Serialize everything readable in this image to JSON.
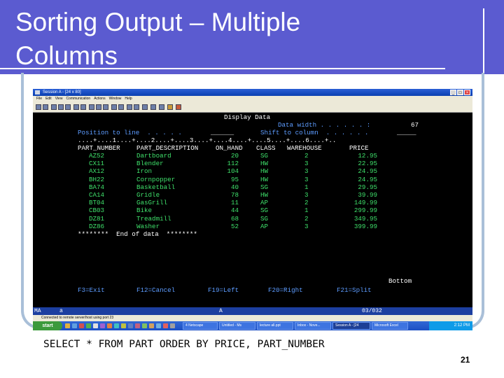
{
  "slide": {
    "title_line1": "Sorting Output – Multiple",
    "title_line2": "Columns",
    "caption": "SELECT * FROM PART ORDER BY PRICE, PART_NUMBER",
    "page_number": "21"
  },
  "window": {
    "title": "Session A - [24 x 80]",
    "menu": [
      "File",
      "Edit",
      "View",
      "Communication",
      "Actions",
      "Window",
      "Help"
    ],
    "controls": [
      "_",
      "□",
      "×"
    ]
  },
  "terminal": {
    "header": "Display Data",
    "data_width_label": "Data width . . . . . . :",
    "data_width_value": "67",
    "position_label": "Position to line  . . . . .",
    "position_value": "______",
    "shift_label": "Shift to column  . . . . . .",
    "shift_value": "_____",
    "ruler": "....+....1....+....2....+....3....+....4....+....5....+....6....+..",
    "columns": [
      "PART_NUMBER",
      "PART_DESCRIPTION",
      "ON_HAND",
      "CLASS",
      "WAREHOUSE",
      "PRICE"
    ],
    "rows": [
      {
        "part_number": "AZ52",
        "description": "Dartboard",
        "on_hand": "20",
        "class": "SG",
        "warehouse": "2",
        "price": "12.95"
      },
      {
        "part_number": "CX11",
        "description": "Blender",
        "on_hand": "112",
        "class": "HW",
        "warehouse": "3",
        "price": "22.95"
      },
      {
        "part_number": "AX12",
        "description": "Iron",
        "on_hand": "104",
        "class": "HW",
        "warehouse": "3",
        "price": "24.95"
      },
      {
        "part_number": "BH22",
        "description": "Cornpopper",
        "on_hand": "95",
        "class": "HW",
        "warehouse": "3",
        "price": "24.95"
      },
      {
        "part_number": "BA74",
        "description": "Basketball",
        "on_hand": "40",
        "class": "SG",
        "warehouse": "1",
        "price": "29.95"
      },
      {
        "part_number": "CA14",
        "description": "Gridle",
        "on_hand": "78",
        "class": "HW",
        "warehouse": "3",
        "price": "39.99"
      },
      {
        "part_number": "BT04",
        "description": "GasGrill",
        "on_hand": "11",
        "class": "AP",
        "warehouse": "2",
        "price": "149.99"
      },
      {
        "part_number": "CB03",
        "description": "Bike",
        "on_hand": "44",
        "class": "SG",
        "warehouse": "1",
        "price": "299.99"
      },
      {
        "part_number": "DZ81",
        "description": "Treadmill",
        "on_hand": "68",
        "class": "SG",
        "warehouse": "2",
        "price": "349.95"
      },
      {
        "part_number": "DZ86",
        "description": "Washer",
        "on_hand": "52",
        "class": "AP",
        "warehouse": "3",
        "price": "399.99"
      }
    ],
    "end_text": "********  End of data  ********",
    "bottom_text": "Bottom",
    "fkeys": [
      "F3=Exit",
      "F12=Cancel",
      "F19=Left",
      "F20=Right",
      "F21=Split"
    ]
  },
  "status_bar": {
    "left": "MA",
    "session": "a",
    "mode": "A",
    "position": "03/032"
  },
  "message_bar": "Connected to remote server/host using port 23",
  "taskbar": {
    "start": "start",
    "tasks": [
      "4 Netscape",
      "Untitled - Ms",
      "lecture all.ppt",
      "Inbox - Nove...",
      "Session A - [24",
      "Microsoft Excel"
    ],
    "time": "2:12 PM"
  },
  "colors": {
    "title_band": "#5b5bd0",
    "terminal_label": "#5d9cff",
    "terminal_data": "#3fe06b",
    "terminal_header": "#ffffff"
  }
}
